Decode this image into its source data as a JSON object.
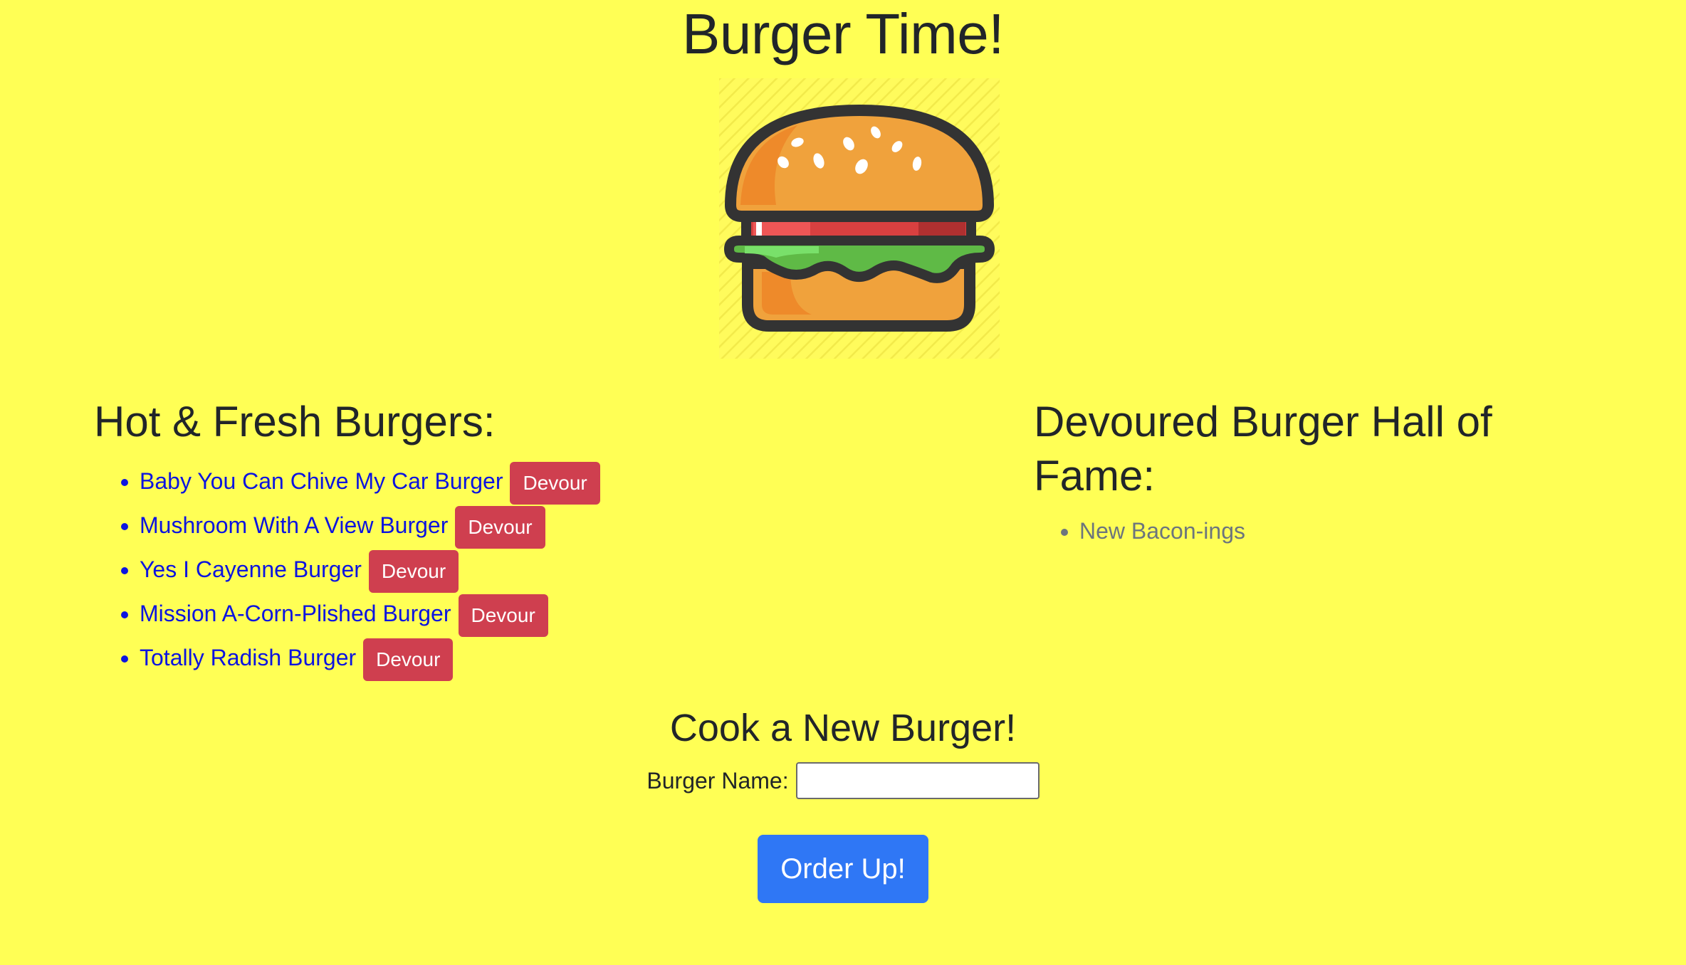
{
  "header": {
    "title": "Burger Time!"
  },
  "hot_fresh": {
    "heading": "Hot & Fresh Burgers:",
    "items": [
      {
        "name": "Baby You Can Chive My Car Burger",
        "button": "Devour"
      },
      {
        "name": "Mushroom With A View Burger",
        "button": "Devour"
      },
      {
        "name": "Yes I Cayenne Burger",
        "button": "Devour"
      },
      {
        "name": "Mission A-Corn-Plished Burger",
        "button": "Devour"
      },
      {
        "name": "Totally Radish Burger",
        "button": "Devour"
      }
    ]
  },
  "hall_of_fame": {
    "heading": "Devoured Burger Hall of Fame:",
    "items": [
      {
        "name": "New Bacon-ings"
      }
    ]
  },
  "cook": {
    "heading": "Cook a New Burger!",
    "label": "Burger Name:",
    "input_value": "",
    "submit_label": "Order Up!"
  },
  "colors": {
    "background": "#ffff55",
    "link": "#0c14e0",
    "devour_button": "#cf3f4f",
    "order_button": "#2f77f5",
    "devoured_text": "#6c757d"
  },
  "icons": {
    "logo": "burger-icon"
  }
}
